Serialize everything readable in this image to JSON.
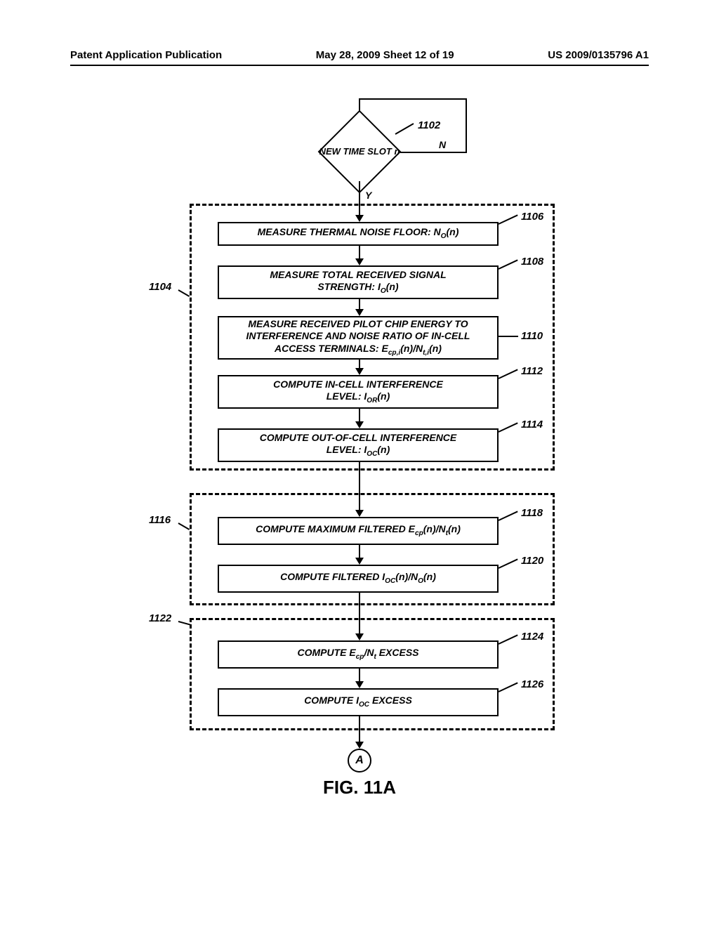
{
  "header": {
    "left": "Patent Application Publication",
    "center": "May 28, 2009  Sheet 12 of 19",
    "right": "US 2009/0135796 A1"
  },
  "figure_label": "FIG. 11A",
  "decision": {
    "label": "NEW TIME SLOT n",
    "yes": "Y",
    "no": "N",
    "ref": "1102"
  },
  "group1_ref": "1104",
  "group2_ref": "1116",
  "group3_ref": "1122",
  "boxes": {
    "b1106": {
      "ref": "1106",
      "text": "MEASURE THERMAL NOISE FLOOR: N",
      "sub1": "O",
      "tail": "(n)"
    },
    "b1108": {
      "ref": "1108",
      "line1": "MEASURE TOTAL RECEIVED SIGNAL",
      "line2": "STRENGTH: I",
      "sub": "O",
      "tail": "(n)"
    },
    "b1110": {
      "ref": "1110",
      "line1": "MEASURE RECEIVED PILOT CHIP ENERGY TO",
      "line2": "INTERFERENCE AND NOISE RATIO OF IN-CELL",
      "line3": "ACCESS TERMINALS: E",
      "sub1": "cp,i",
      "mid": "(n)/N",
      "sub2": "t,i",
      "tail": "(n)"
    },
    "b1112": {
      "ref": "1112",
      "line1": "COMPUTE IN-CELL INTERFERENCE",
      "line2": "LEVEL: I",
      "sub": "OR",
      "tail": "(n)"
    },
    "b1114": {
      "ref": "1114",
      "line1": "COMPUTE OUT-OF-CELL INTERFERENCE",
      "line2": "LEVEL: I",
      "sub": "OC",
      "tail": "(n)"
    },
    "b1118": {
      "ref": "1118",
      "pre": "COMPUTE MAXIMUM FILTERED  E",
      "sub1": "cp",
      "mid": "(n)/N",
      "sub2": "t",
      "tail": "(n)"
    },
    "b1120": {
      "ref": "1120",
      "pre": "COMPUTE FILTERED  I",
      "sub1": "OC",
      "mid": "(n)/N",
      "sub2": "O",
      "tail": "(n)"
    },
    "b1124": {
      "ref": "1124",
      "pre": "COMPUTE E",
      "sub1": "cp",
      "mid": "/N",
      "sub2": "t",
      "tail": " EXCESS"
    },
    "b1126": {
      "ref": "1126",
      "pre": "COMPUTE I",
      "sub1": "OC",
      "tail": " EXCESS"
    }
  },
  "connector": "A"
}
